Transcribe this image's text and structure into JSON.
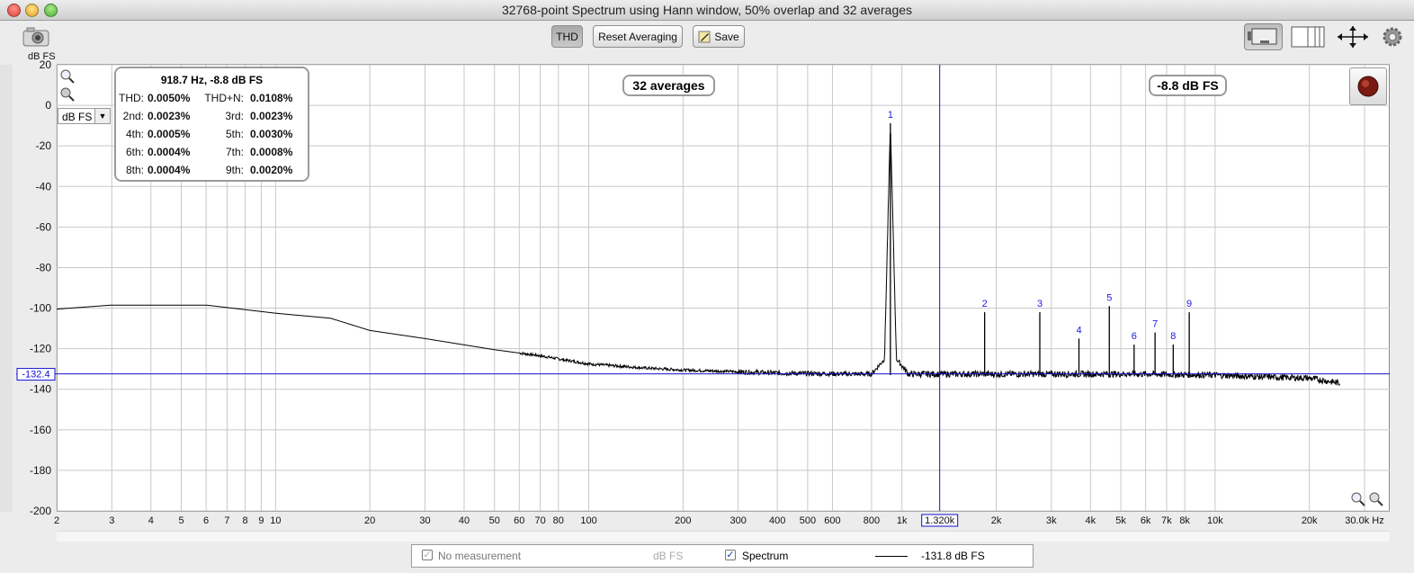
{
  "window": {
    "title": "32768-point Spectrum using Hann window, 50% overlap and 32 averages"
  },
  "toolbar": {
    "thd_label": "THD",
    "reset_label": "Reset Averaging",
    "save_label": "Save",
    "unit_label": "dB FS",
    "icons": [
      "camera-icon",
      "layout-icon",
      "columns-icon",
      "expand-arrows-icon",
      "gear-icon"
    ]
  },
  "chart_data": {
    "type": "line",
    "title": "",
    "xlabel": "Hz",
    "ylabel": "dB FS",
    "x_scale": "log",
    "xlim": [
      2,
      30000
    ],
    "ylim": [
      -200,
      20
    ],
    "grid": true,
    "y_ticks": [
      "20",
      "0",
      "-20",
      "-40",
      "-60",
      "-80",
      "-100",
      "-120",
      "-140",
      "-160",
      "-180",
      "-200"
    ],
    "x_ticks": [
      "2",
      "3",
      "4",
      "5",
      "6",
      "7",
      "8",
      "9",
      "10",
      "20",
      "30",
      "40",
      "50",
      "60",
      "70",
      "80",
      "100",
      "200",
      "300",
      "400",
      "500",
      "600",
      "800",
      "1k",
      "1.320k",
      "2k",
      "3k",
      "4k",
      "5k",
      "6k",
      "7k",
      "8k",
      "10k",
      "20k",
      "30.0k Hz"
    ],
    "series": [
      {
        "name": "Spectrum",
        "x": [
          2,
          3,
          6,
          10,
          15,
          20,
          30,
          50,
          70,
          100,
          150,
          200,
          400,
          700,
          800,
          880,
          918.7,
          960,
          1050,
          1500,
          3000,
          6000,
          10000,
          15000,
          20000,
          25000
        ],
        "y": [
          -100.5,
          -98.5,
          -98.5,
          -102.5,
          -105,
          -111,
          -115,
          -120.5,
          -123.5,
          -127.5,
          -129.5,
          -130.5,
          -132,
          -132.5,
          -132.5,
          -125,
          -8.8,
          -125,
          -132.5,
          -132.5,
          -132.5,
          -132.5,
          -133,
          -134,
          -134.5,
          -137
        ]
      }
    ],
    "harmonics": [
      {
        "label": "1",
        "freq": 918.7,
        "level": -8.8
      },
      {
        "label": "2",
        "freq": 1837,
        "level": -102
      },
      {
        "label": "3",
        "freq": 2756,
        "level": -102
      },
      {
        "label": "4",
        "freq": 3675,
        "level": -115
      },
      {
        "label": "5",
        "freq": 4594,
        "level": -99
      },
      {
        "label": "6",
        "freq": 5512,
        "level": -118
      },
      {
        "label": "7",
        "freq": 6431,
        "level": -112
      },
      {
        "label": "8",
        "freq": 7350,
        "level": -118
      },
      {
        "label": "9",
        "freq": 8268,
        "level": -102
      }
    ],
    "cursor": {
      "x_label": "1.320k",
      "y_label": "-132.4",
      "x": 1320,
      "y": -132.4
    },
    "annotations": {
      "averages": "32 averages",
      "peak": "-8.8 dB FS"
    }
  },
  "thd_readout": {
    "header": "918.7 Hz, -8.8 dB FS",
    "rows": [
      {
        "l1": "THD:",
        "v1": "0.0050%",
        "l2": "THD+N:",
        "v2": "0.0108%"
      },
      {
        "l1": "2nd:",
        "v1": "0.0023%",
        "l2": "3rd:",
        "v2": "0.0023%"
      },
      {
        "l1": "4th:",
        "v1": "0.0005%",
        "l2": "5th:",
        "v2": "0.0030%"
      },
      {
        "l1": "6th:",
        "v1": "0.0004%",
        "l2": "7th:",
        "v2": "0.0008%"
      },
      {
        "l1": "8th:",
        "v1": "0.0004%",
        "l2": "9th:",
        "v2": "0.0020%"
      }
    ]
  },
  "unit_selector": {
    "value": "dB FS"
  },
  "legend": {
    "item1_label": "No measurement",
    "item1_unit": "dB FS",
    "item2_label": "Spectrum",
    "item2_value": "-131.8 dB FS"
  },
  "colors": {
    "trace": "#000000",
    "cursor": "#1010d0",
    "harmonic_label": "#1a1adf",
    "grid": "#c8c8c8"
  }
}
